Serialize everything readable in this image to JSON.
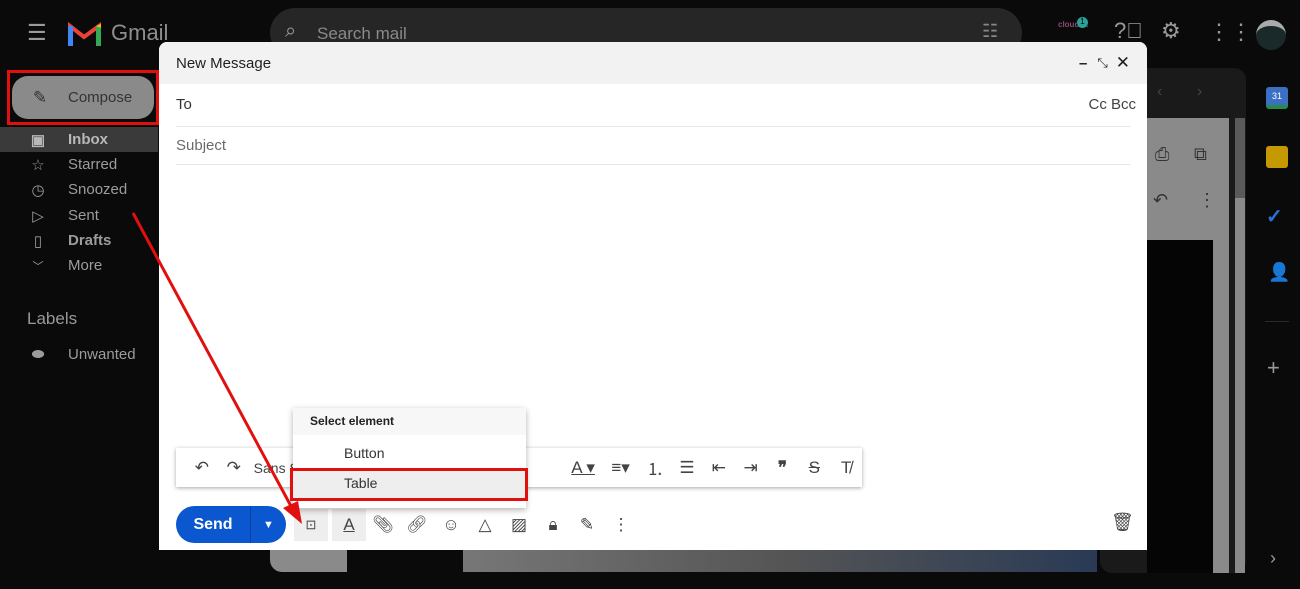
{
  "app": {
    "name": "Gmail"
  },
  "search": {
    "placeholder": "Search mail"
  },
  "header": {
    "badge": "cloudHQ",
    "badge_count": "1"
  },
  "sidebar": {
    "compose_label": "Compose",
    "items": [
      {
        "label": "Inbox",
        "icon": "inbox-icon"
      },
      {
        "label": "Starred",
        "icon": "star-icon"
      },
      {
        "label": "Snoozed",
        "icon": "clock-icon"
      },
      {
        "label": "Sent",
        "icon": "send-icon"
      },
      {
        "label": "Drafts",
        "icon": "draft-icon"
      },
      {
        "label": "More",
        "icon": "chevron-down-icon"
      }
    ],
    "labels_title": "Labels",
    "labels": [
      {
        "label": "Unwanted"
      }
    ]
  },
  "compose": {
    "title": "New Message",
    "to_label": "To",
    "cc_bcc": "Cc Bcc",
    "subject_placeholder": "Subject",
    "font": "Sans Serif",
    "send_label": "Send"
  },
  "dropdown": {
    "header": "Select element",
    "items": [
      "Button",
      "Table"
    ],
    "selected": "Table"
  },
  "colors": {
    "accent": "#0b57d0",
    "annotation": "#e0100f"
  }
}
